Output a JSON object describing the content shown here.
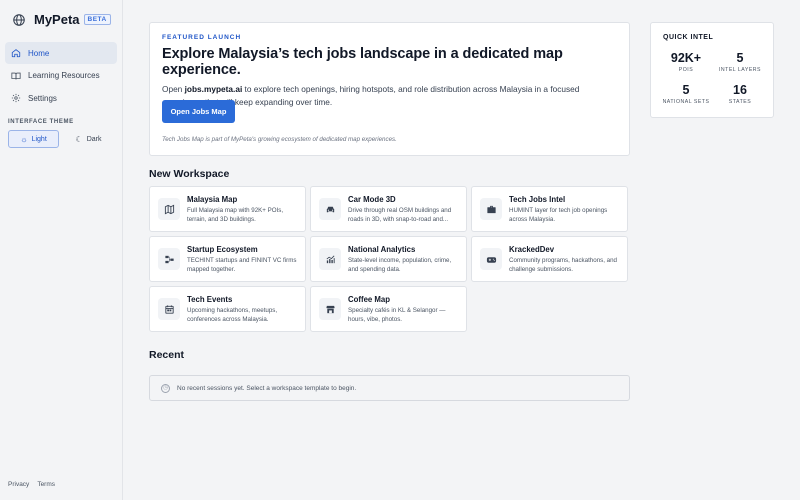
{
  "sidebar": {
    "brand": {
      "name": "MyPeta",
      "badge": "BETA"
    },
    "nav": [
      {
        "label": "Home",
        "icon": "home-icon",
        "active": true
      },
      {
        "label": "Learning Resources",
        "icon": "book-icon",
        "active": false
      },
      {
        "label": "Settings",
        "icon": "gear-icon",
        "active": false
      }
    ],
    "theme": {
      "label": "INTERFACE THEME",
      "light": "Light",
      "dark": "Dark",
      "selected": "Light"
    },
    "footer": {
      "privacy": "Privacy",
      "terms": "Terms"
    }
  },
  "hero": {
    "kicker": "FEATURED LAUNCH",
    "title": "Explore Malaysia’s tech jobs landscape in a dedicated map experience.",
    "desc_prefix": "Open ",
    "desc_link": "jobs.mypeta.ai",
    "desc_suffix": " to explore tech openings, hiring hotspots, and role distribution across Malaysia in a focused experience that will keep expanding over time.",
    "button": "Open Jobs Map",
    "note": "Tech Jobs Map is part of MyPeta's growing ecosystem of dedicated map experiences."
  },
  "intel": {
    "title": "QUICK INTEL",
    "stats": [
      {
        "value": "92K+",
        "label": "POIS"
      },
      {
        "value": "5",
        "label": "INTEL LAYERS"
      },
      {
        "value": "5",
        "label": "NATIONAL SETS"
      },
      {
        "value": "16",
        "label": "STATES"
      }
    ]
  },
  "workspace": {
    "title": "New Workspace",
    "tiles": [
      {
        "title": "Malaysia Map",
        "desc": "Full Malaysia map with 92K+ POIs, terrain, and 3D buildings.",
        "icon": "map-icon"
      },
      {
        "title": "Car Mode 3D",
        "desc": "Drive through real OSM buildings and roads in 3D, with snap-to-road and...",
        "icon": "car-icon"
      },
      {
        "title": "Tech Jobs Intel",
        "desc": "HUMINT layer for tech job openings across Malaysia.",
        "icon": "briefcase-icon"
      },
      {
        "title": "Startup Ecosystem",
        "desc": "TECHINT startups and FININT VC firms mapped together.",
        "icon": "network-icon"
      },
      {
        "title": "National Analytics",
        "desc": "State-level income, population, crime, and spending data.",
        "icon": "analytics-icon"
      },
      {
        "title": "KrackedDev",
        "desc": "Community programs, hackathons, and challenge submissions.",
        "icon": "gamepad-icon"
      },
      {
        "title": "Tech Events",
        "desc": "Upcoming hackathons, meetups, conferences across Malaysia.",
        "icon": "calendar-icon"
      },
      {
        "title": "Coffee Map",
        "desc": "Specialty cafés in KL & Selangor — hours, vibe, photos.",
        "icon": "store-icon"
      }
    ]
  },
  "recent": {
    "title": "Recent",
    "empty": "No recent sessions yet. Select a workspace template to begin."
  }
}
